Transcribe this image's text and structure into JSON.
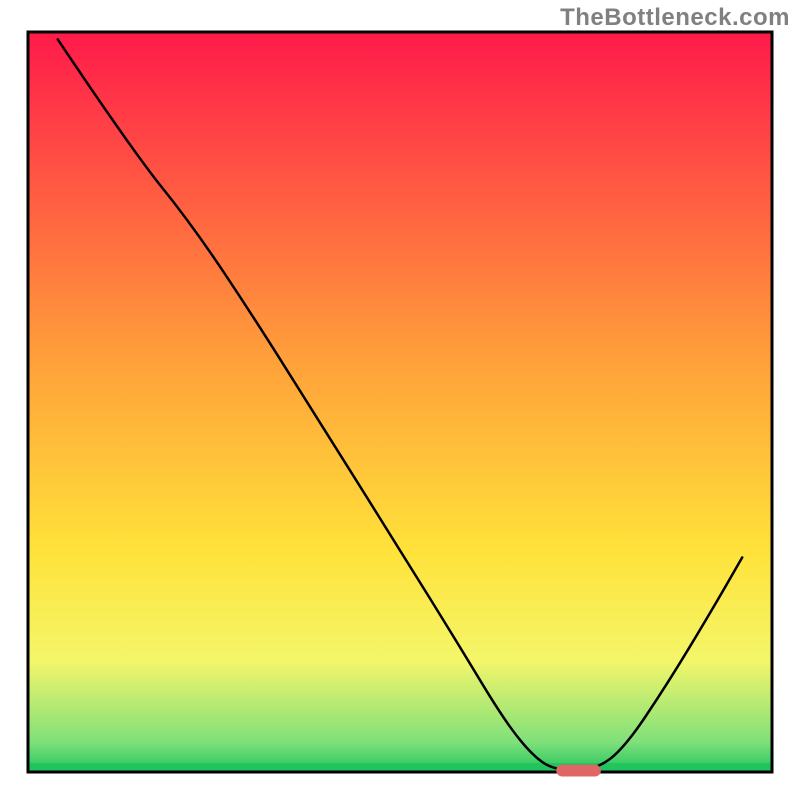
{
  "watermark": "TheBottleneck.com",
  "chart_data": {
    "type": "line",
    "title": "",
    "xlabel": "",
    "ylabel": "",
    "xlim": [
      0,
      100
    ],
    "ylim": [
      0,
      100
    ],
    "background_gradient": {
      "stops": [
        {
          "offset": 0.0,
          "color": "#ff1a4a"
        },
        {
          "offset": 0.45,
          "color": "#ffa23a"
        },
        {
          "offset": 0.7,
          "color": "#ffe23a"
        },
        {
          "offset": 0.85,
          "color": "#f4f66a"
        },
        {
          "offset": 0.96,
          "color": "#7fe07a"
        },
        {
          "offset": 1.0,
          "color": "#22c45e"
        }
      ]
    },
    "border_color": "#000000",
    "series": [
      {
        "name": "bottleneck-curve",
        "color": "#000000",
        "stroke_width": 2.5,
        "points": [
          {
            "x": 4.0,
            "y": 99.0
          },
          {
            "x": 14.0,
            "y": 84.0
          },
          {
            "x": 22.0,
            "y": 74.0
          },
          {
            "x": 30.0,
            "y": 62.0
          },
          {
            "x": 40.0,
            "y": 46.0
          },
          {
            "x": 50.0,
            "y": 30.0
          },
          {
            "x": 58.0,
            "y": 17.0
          },
          {
            "x": 64.0,
            "y": 7.0
          },
          {
            "x": 68.0,
            "y": 2.0
          },
          {
            "x": 71.0,
            "y": 0.2
          },
          {
            "x": 76.0,
            "y": 0.2
          },
          {
            "x": 80.0,
            "y": 3.0
          },
          {
            "x": 86.0,
            "y": 12.0
          },
          {
            "x": 92.0,
            "y": 22.0
          },
          {
            "x": 96.0,
            "y": 29.0
          }
        ]
      }
    ],
    "marker": {
      "name": "optimal-marker",
      "color": "#e06666",
      "x_start": 71.0,
      "x_end": 77.0,
      "y": 0.2,
      "thickness": 1.6
    }
  }
}
